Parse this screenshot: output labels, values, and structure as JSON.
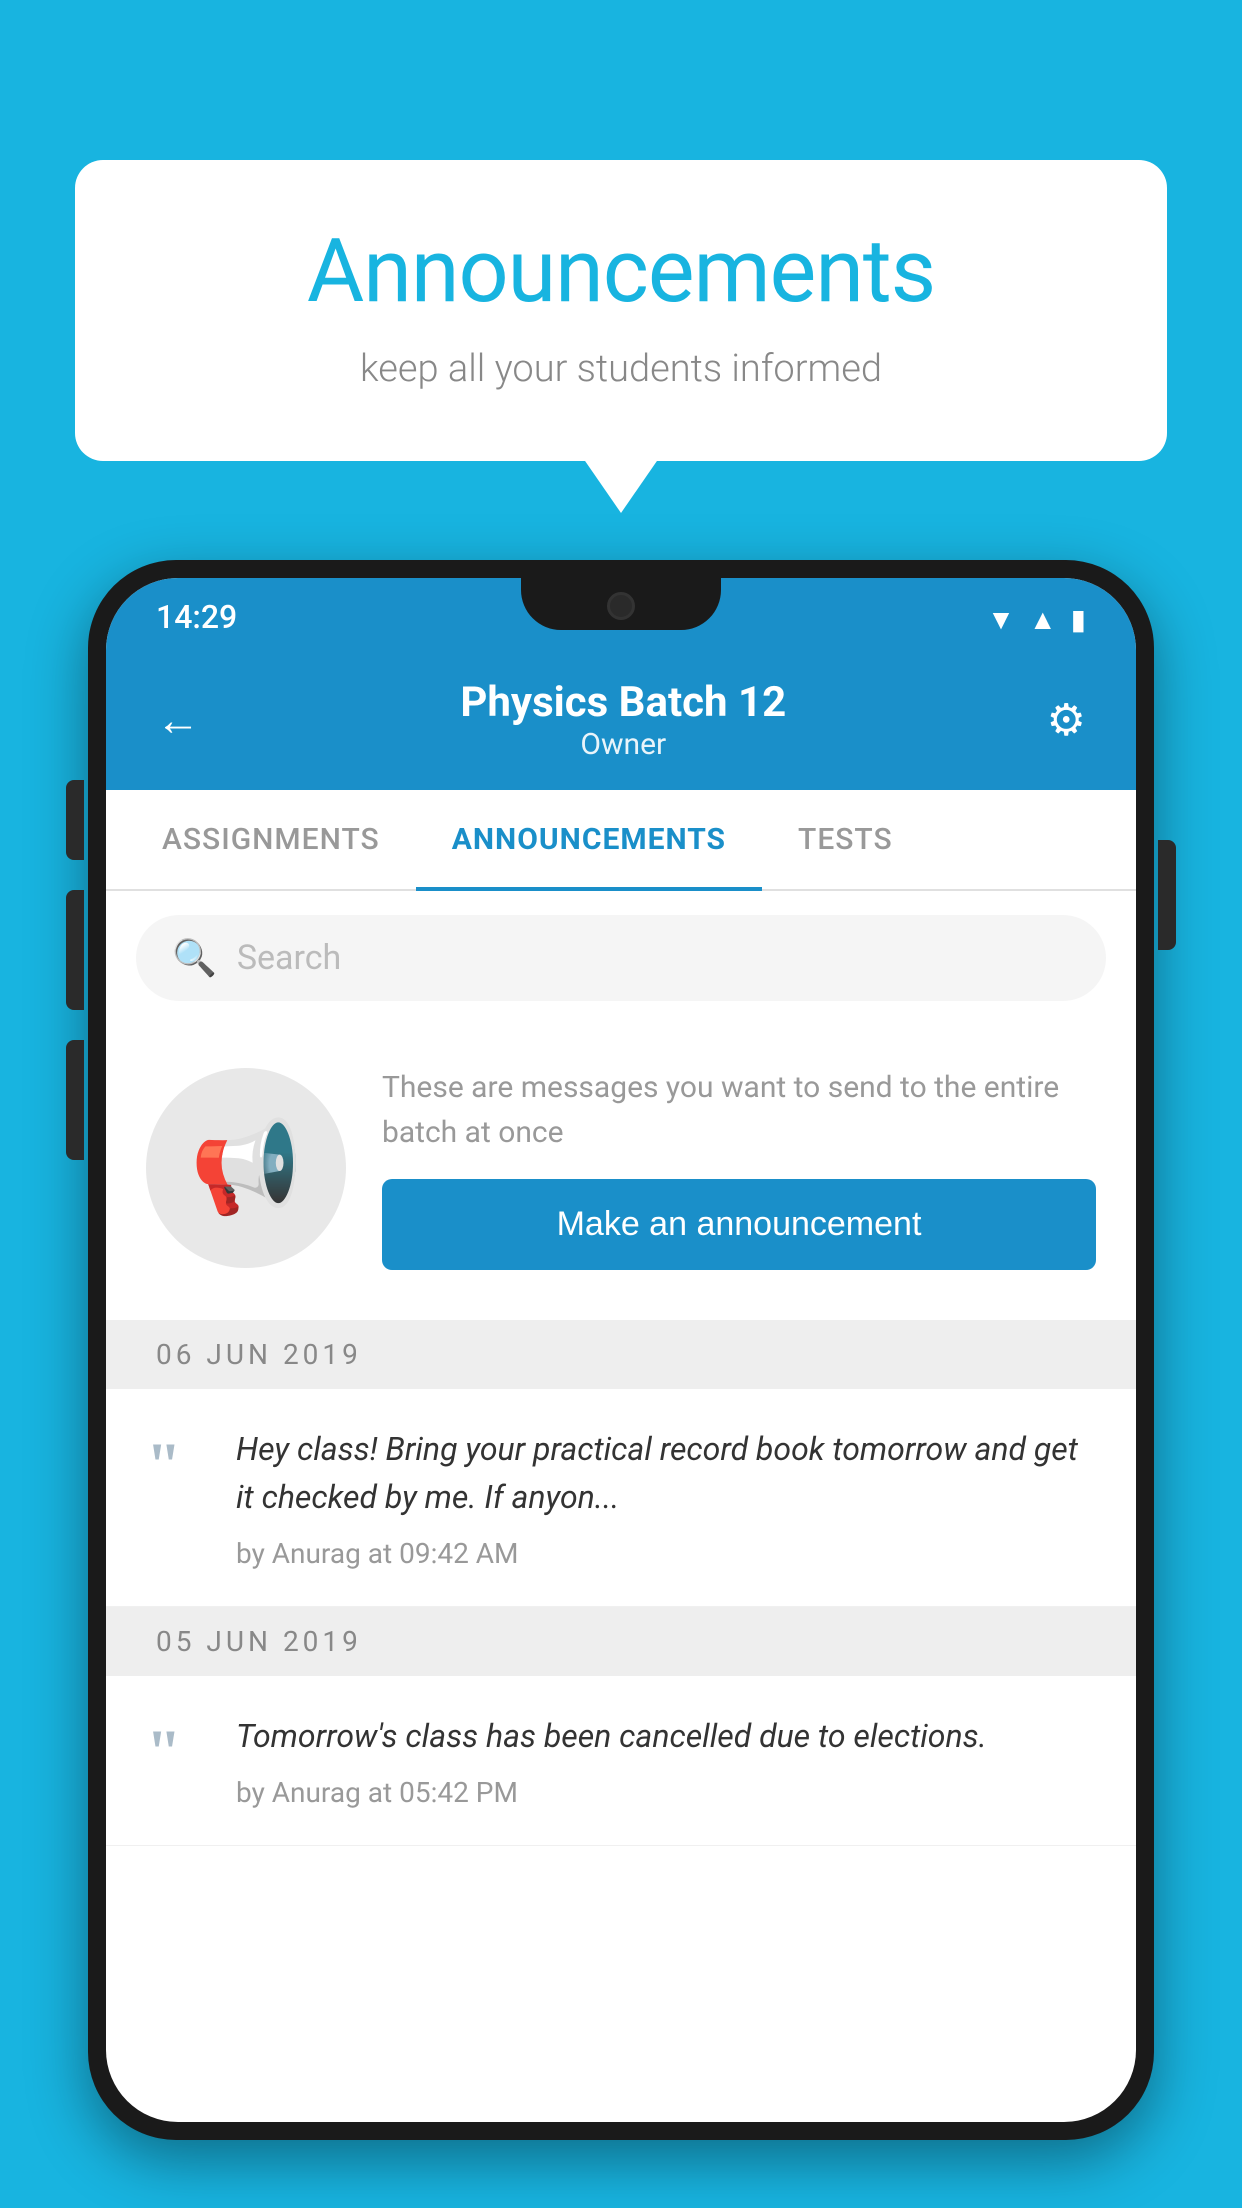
{
  "page": {
    "background_color": "#18b4e0"
  },
  "speech_bubble": {
    "title": "Announcements",
    "subtitle": "keep all your students informed"
  },
  "phone": {
    "status_bar": {
      "time": "14:29"
    },
    "header": {
      "title": "Physics Batch 12",
      "subtitle": "Owner",
      "back_label": "←",
      "gear_label": "⚙"
    },
    "tabs": [
      {
        "label": "ASSIGNMENTS",
        "active": false
      },
      {
        "label": "ANNOUNCEMENTS",
        "active": true
      },
      {
        "label": "TESTS",
        "active": false
      }
    ],
    "search": {
      "placeholder": "Search"
    },
    "promo": {
      "description": "These are messages you want to send to the entire batch at once",
      "button_label": "Make an announcement"
    },
    "announcements": [
      {
        "date": "06  JUN  2019",
        "text": "Hey class! Bring your practical record book tomorrow and get it checked by me. If anyon...",
        "meta": "by Anurag at 09:42 AM"
      },
      {
        "date": "05  JUN  2019",
        "text": "Tomorrow's class has been cancelled due to elections.",
        "meta": "by Anurag at 05:42 PM"
      }
    ]
  }
}
